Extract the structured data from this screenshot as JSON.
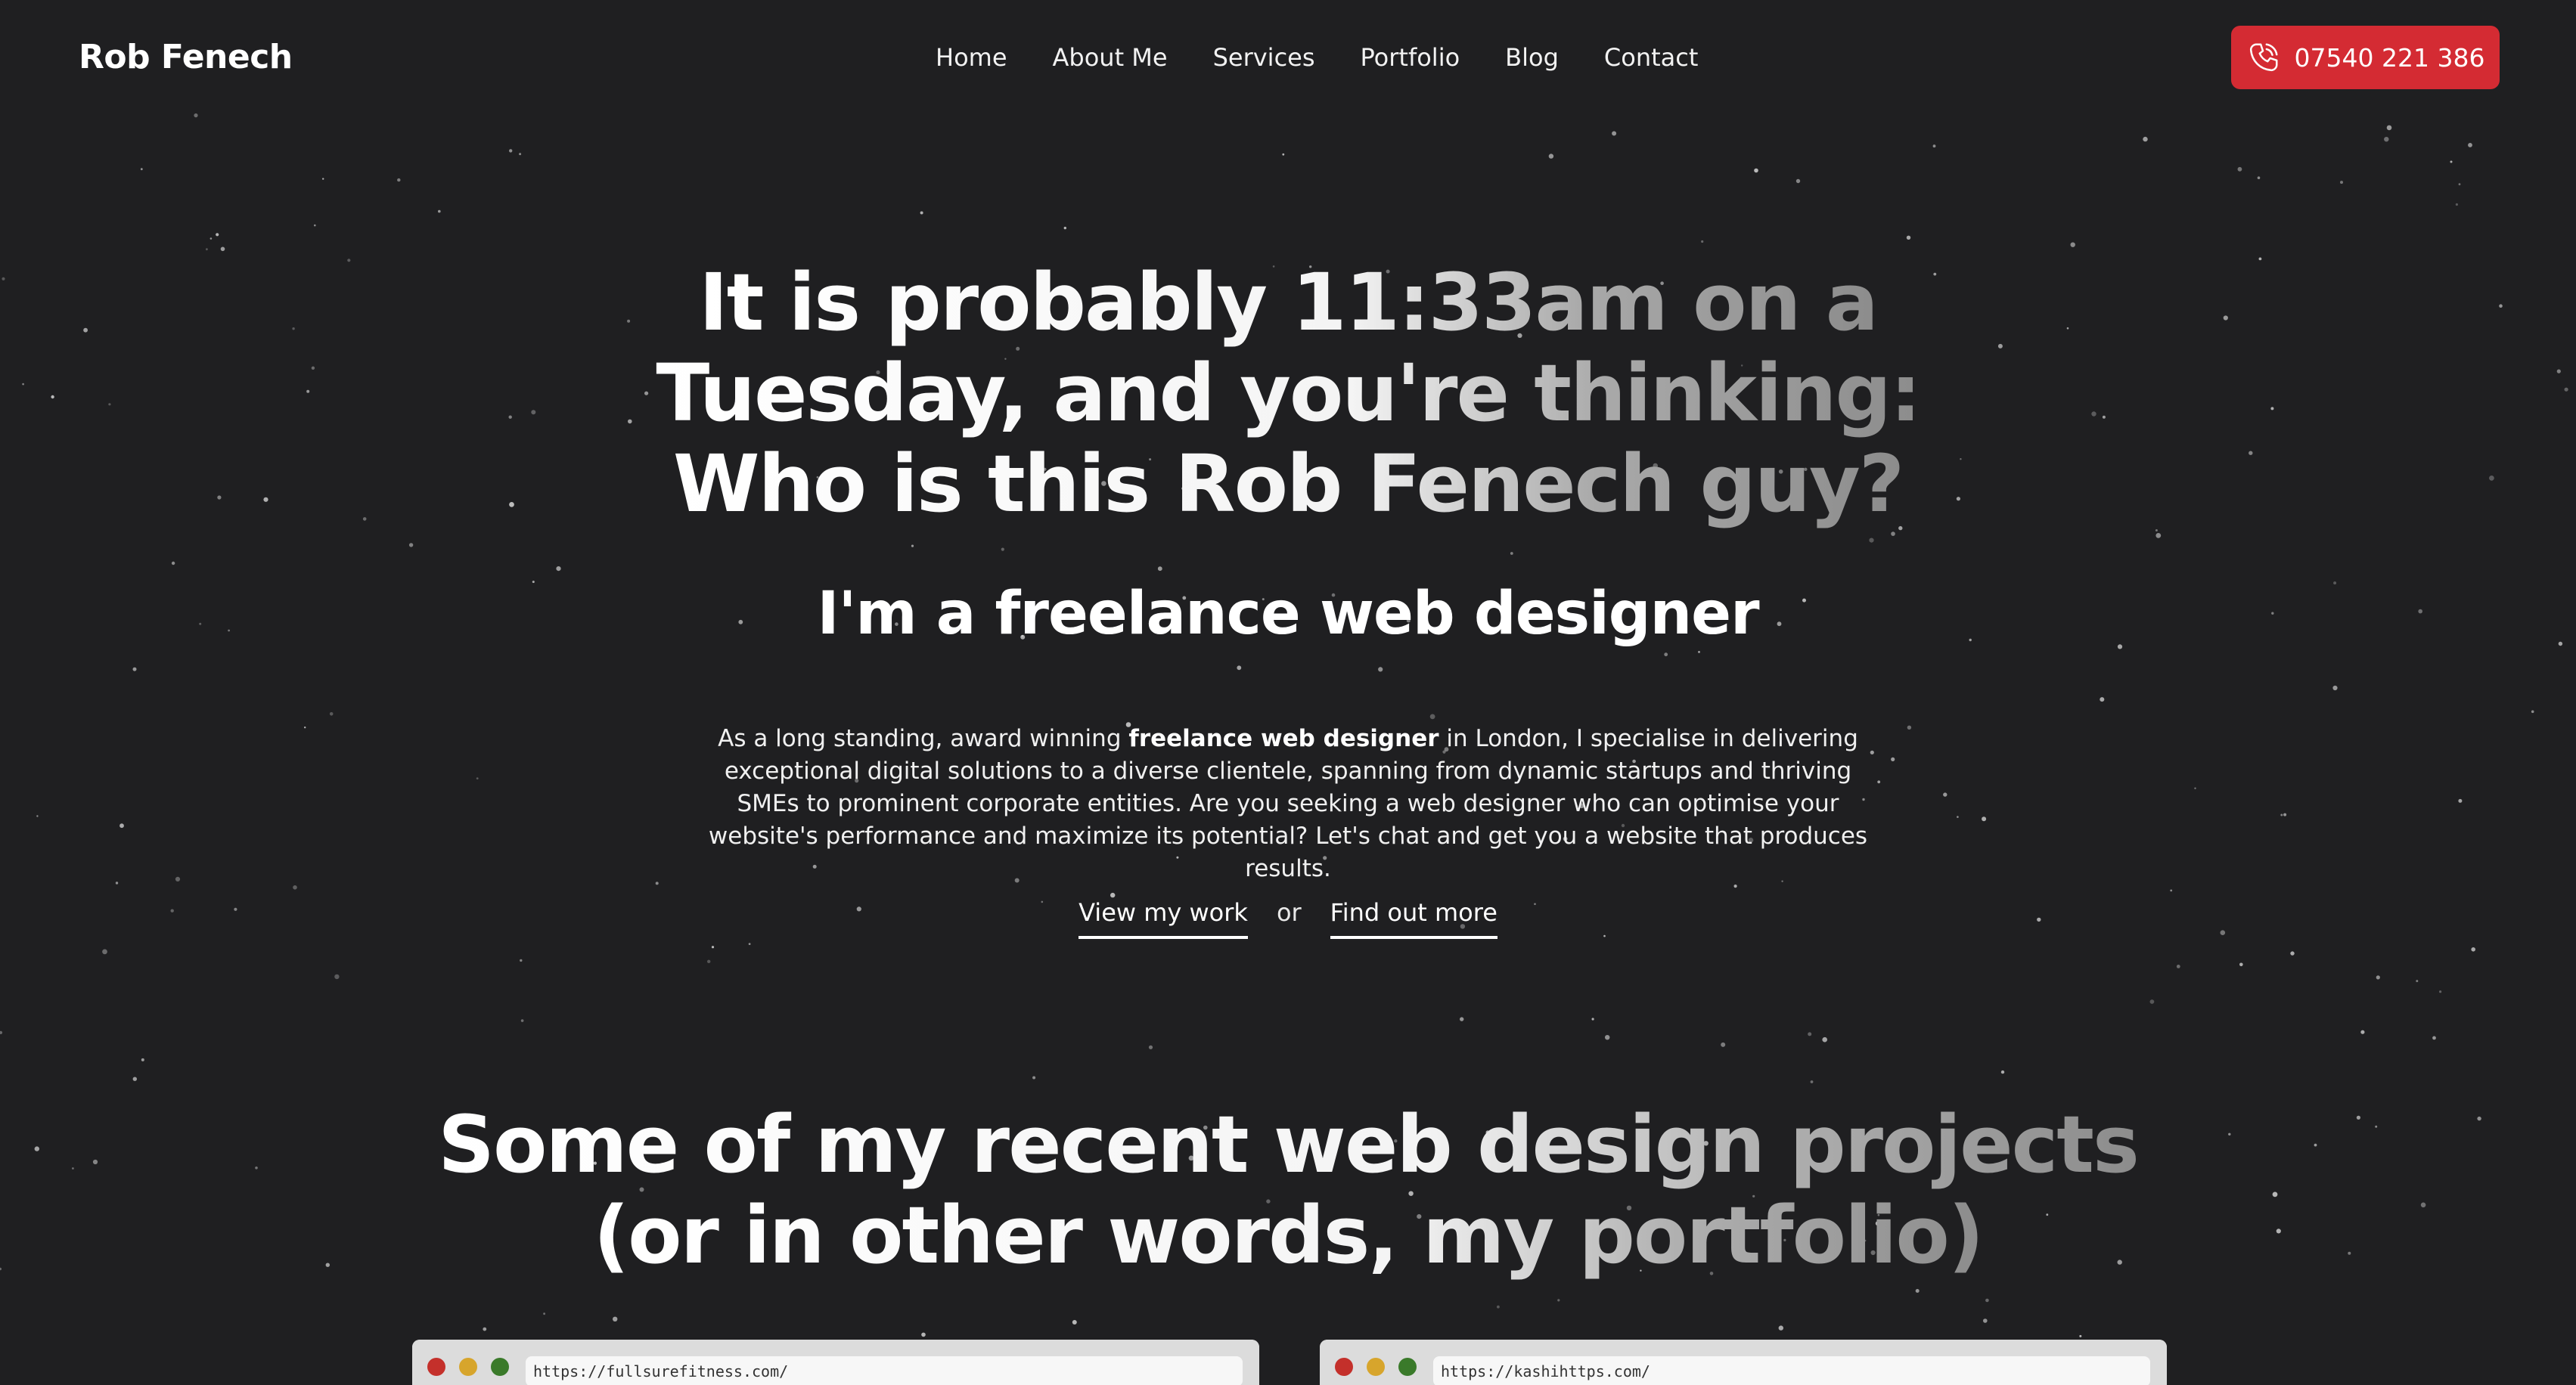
{
  "header": {
    "brand": "Rob Fenech",
    "nav": [
      "Home",
      "About Me",
      "Services",
      "Portfolio",
      "Blog",
      "Contact"
    ],
    "phone": "07540 221 386",
    "phone_icon": "phone-icon",
    "phone_button_color": "#d42b33"
  },
  "hero": {
    "title_lines": [
      "It is probably 11:33am on a",
      "Tuesday, and you're thinking:",
      "Who is this Rob Fenech guy?"
    ],
    "subtitle": "I'm a freelance web designer",
    "intro": {
      "before": "As a long standing, award winning ",
      "bold": "freelance web designer",
      "after": " in London, I specialise in delivering exceptional digital solutions to a diverse clientele, spanning from dynamic startups and thriving SMEs to prominent corporate entities. Are you seeking a web designer who can optimise your website's performance and maximize its potential? Let's chat and get you a website that produces results."
    },
    "cta_primary": "View my work",
    "cta_separator": "or",
    "cta_secondary": "Find out more"
  },
  "portfolio": {
    "title_lines": [
      "Some of my recent web design projects",
      "(or in other words, my portfolio)"
    ],
    "cards": [
      {
        "url": "https://fullsurefitness.com/"
      },
      {
        "url": "https://kashihttps.com/"
      }
    ]
  },
  "colors": {
    "background": "#1f1f21",
    "accent": "#d42b33",
    "text": "#ffffff"
  }
}
